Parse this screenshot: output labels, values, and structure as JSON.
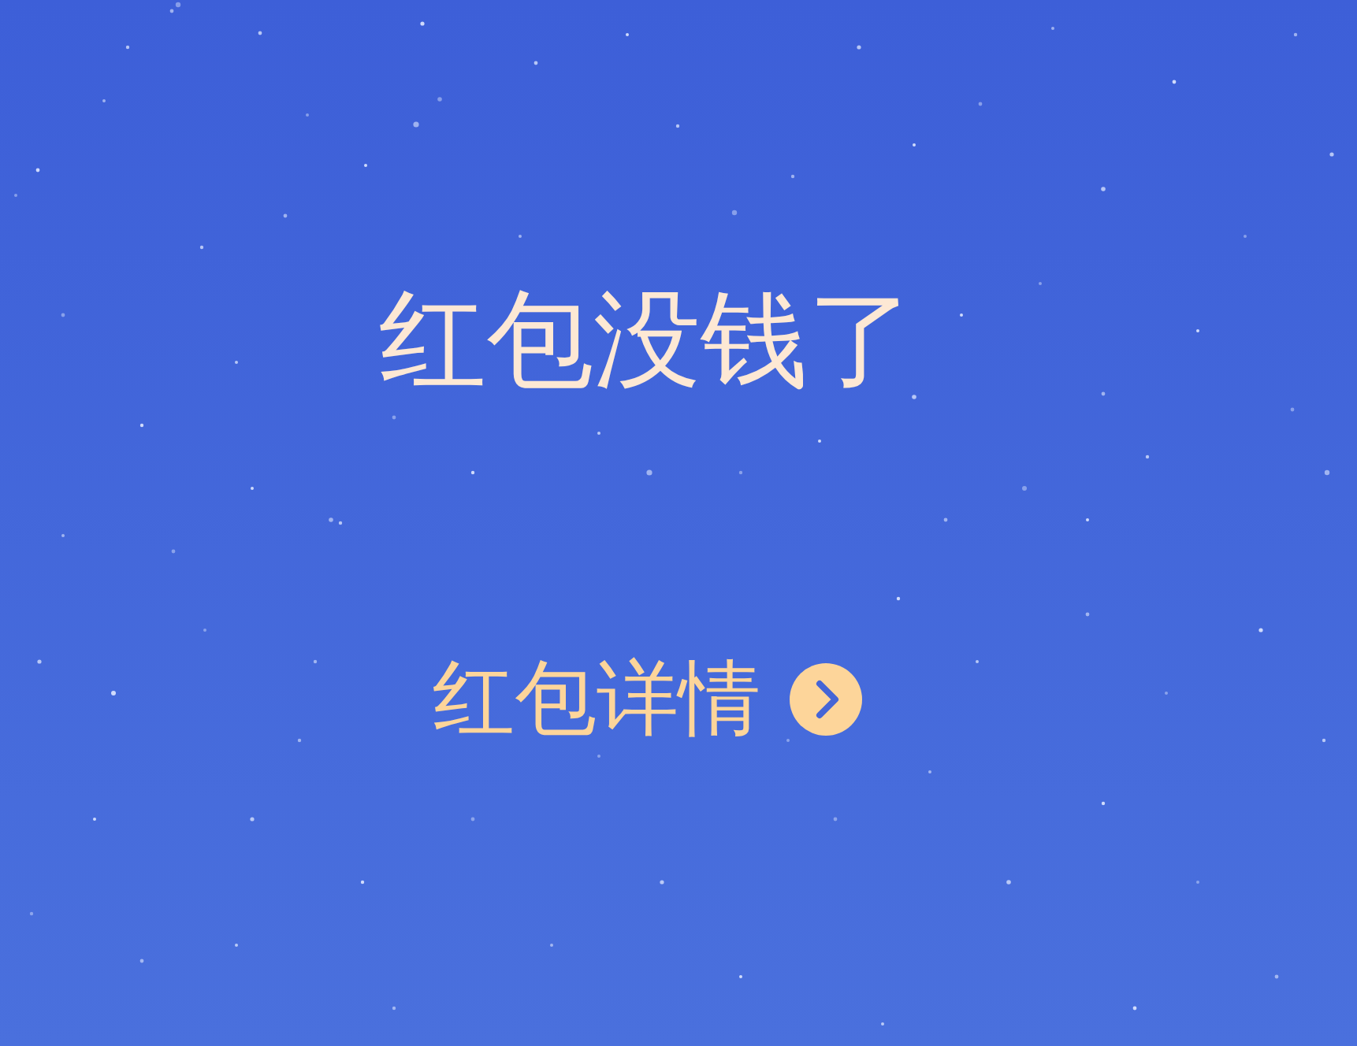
{
  "title": "红包没钱了",
  "details_link": {
    "label": "红包详情"
  }
}
